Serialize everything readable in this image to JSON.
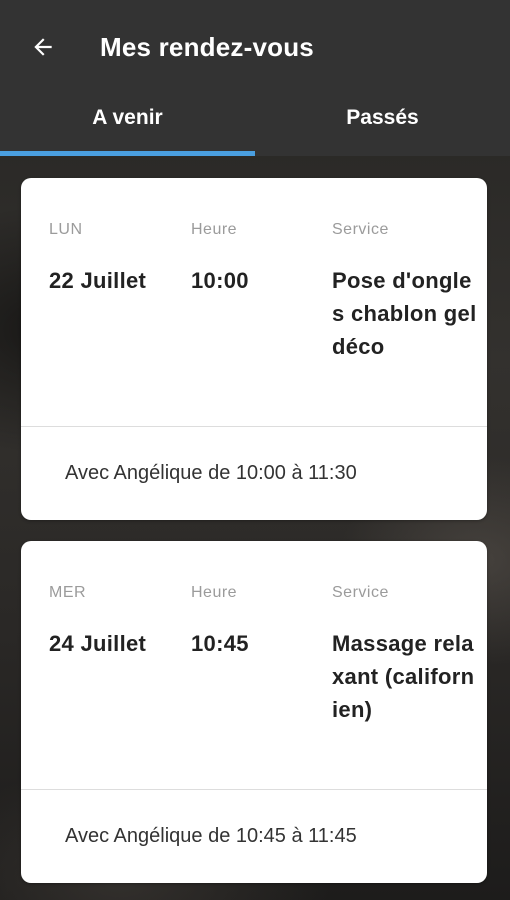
{
  "header": {
    "title": "Mes rendez-vous",
    "back_icon": "arrow-left-icon"
  },
  "tabs": [
    {
      "label": "A venir",
      "selected": true
    },
    {
      "label": "Passés",
      "selected": false
    }
  ],
  "colors": {
    "appbar": "#333333",
    "tab_indicator": "#4a9fe0",
    "card": "#ffffff"
  },
  "appointments": [
    {
      "day_label": "LUN",
      "date": "22 Juillet",
      "time_label": "Heure",
      "time": "10:00",
      "service_label": "Service",
      "service": "Pose d'ongles chablon gel déco",
      "details": "Avec Angélique de 10:00 à 11:30"
    },
    {
      "day_label": "MER",
      "date": "24 Juillet",
      "time_label": "Heure",
      "time": "10:45",
      "service_label": "Service",
      "service": "Massage relaxant (californien)",
      "details": "Avec Angélique de 10:45 à 11:45"
    }
  ]
}
